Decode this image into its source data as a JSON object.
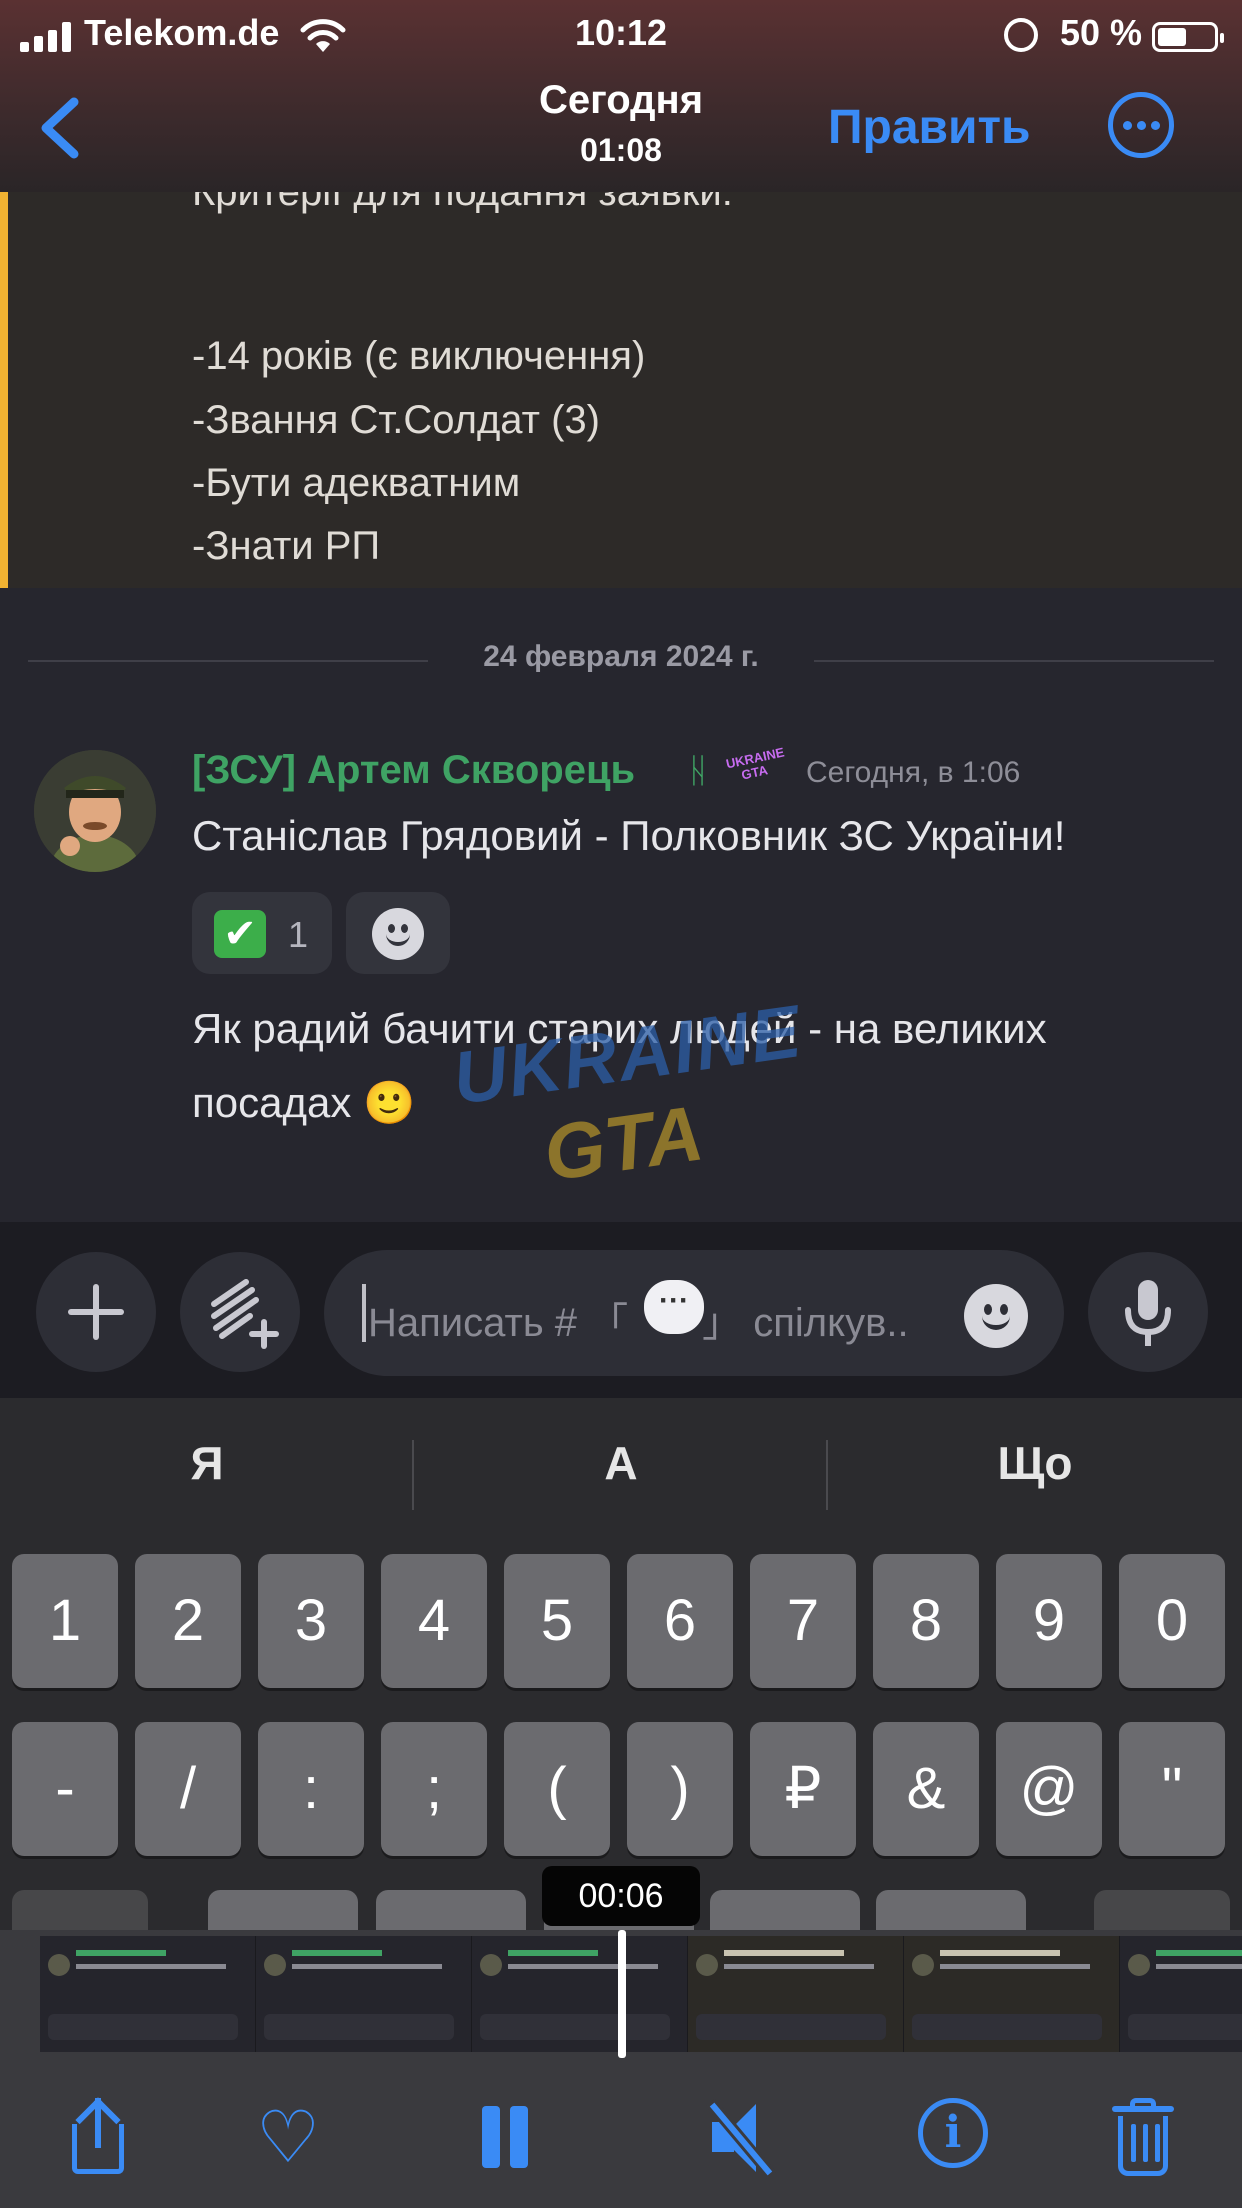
{
  "status_bar": {
    "carrier": "Telekom.de",
    "time": "10:12",
    "battery": "50 %"
  },
  "nav": {
    "title": "Сегодня",
    "subtitle": "01:08",
    "edit_label": "Править"
  },
  "embed": {
    "lines": [
      "Критерії для подання заявки:",
      "-14 років (є виключення)",
      "-Звання  Ст.Солдат (3)",
      "-Бути адекватним",
      "-Знати РП"
    ]
  },
  "date_divider": "24 февраля 2024 г.",
  "message": {
    "author": "[ЗСУ] Артем Скворець",
    "author_tag": "ᚺ",
    "server_badge": "UKRAINE GTA",
    "time": "Сегодня, в 1:06",
    "text": "Станіслав Грядовий - Полковник ЗС України!",
    "reactions": [
      {
        "emoji": "✔",
        "count": "1"
      },
      {
        "emoji": "add-reaction-icon",
        "count": ""
      }
    ],
    "text2": "Як радий бачити старих людей - на великих посадах 🙂"
  },
  "watermark": {
    "line1": "UKRAINE",
    "line2": "GTA"
  },
  "composer": {
    "placeholder_left": "Написать #  「",
    "placeholder_right": "」 спілкув..",
    "channel_icon": "💬"
  },
  "keyboard": {
    "suggestions": [
      "Я",
      "А",
      "Що"
    ],
    "row1": [
      "1",
      "2",
      "3",
      "4",
      "5",
      "6",
      "7",
      "8",
      "9",
      "0"
    ],
    "row2": [
      "-",
      "/",
      ":",
      ";",
      "(",
      ")",
      "₽",
      "&",
      "@",
      "\""
    ],
    "video_time": "00:06"
  },
  "colors": {
    "accent": "#3a8bf5",
    "author": "#3fa364",
    "embed_bar": "#f0b232"
  }
}
